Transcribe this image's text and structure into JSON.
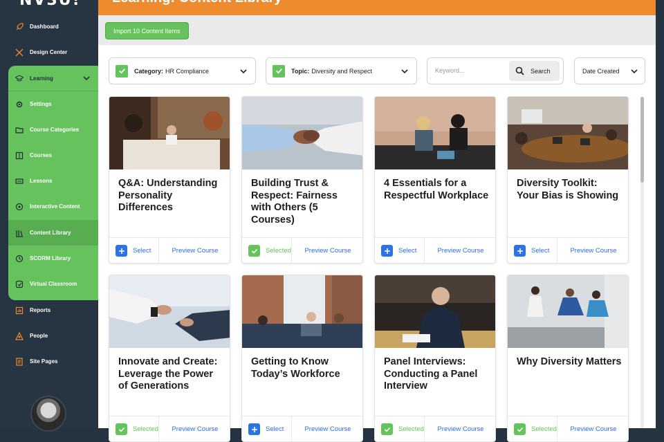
{
  "app": {
    "logo": "NV3U!"
  },
  "header": {
    "title": "Learning: Content Library",
    "import_label": "Import 10 Content Items"
  },
  "sidebar": {
    "items": [
      {
        "label": "Dashboard",
        "icon": "rocket-icon"
      },
      {
        "label": "Design Center",
        "icon": "tools-icon"
      },
      {
        "label": "Learning",
        "icon": "graduation-cap-icon"
      },
      {
        "label": "Settings",
        "icon": "gear-icon"
      },
      {
        "label": "Course Categories",
        "icon": "folder-icon"
      },
      {
        "label": "Courses",
        "icon": "book-icon"
      },
      {
        "label": "Lessons",
        "icon": "lessons-icon"
      },
      {
        "label": "Interactive Content",
        "icon": "puzzle-icon"
      },
      {
        "label": "Content Library",
        "icon": "library-icon"
      },
      {
        "label": "SCORM Library",
        "icon": "scorm-icon"
      },
      {
        "label": "Virtual Classroom",
        "icon": "classroom-icon"
      },
      {
        "label": "Reports",
        "icon": "chart-icon"
      },
      {
        "label": "People",
        "icon": "people-icon"
      },
      {
        "label": "Site Pages",
        "icon": "pages-icon"
      }
    ]
  },
  "filters": {
    "category": {
      "label": "Category:",
      "value": "HR Compliance"
    },
    "topic": {
      "label": "Topic:",
      "value": "Diversity and Respect"
    },
    "keyword_placeholder": "Keyword...",
    "search_label": "Search",
    "sort_label": "Date Created"
  },
  "cards": [
    {
      "title": "Q&A: Understanding Personality Differences",
      "select": "Select",
      "selected": false,
      "preview": "Preview Course"
    },
    {
      "title": "Building Trust & Respect: Fairness with Others (5 Courses)",
      "select": "Selected",
      "selected": true,
      "preview": "Preview Course"
    },
    {
      "title": "4 Essentials for a Respectful Workplace",
      "select": "Select",
      "selected": false,
      "preview": "Preview Course"
    },
    {
      "title": "Diversity Toolkit: Your Bias is Showing",
      "select": "Select",
      "selected": false,
      "preview": "Preview Course"
    },
    {
      "title": "Innovate and Create: Leverage the Power of Generations",
      "select": "Selected",
      "selected": true,
      "preview": "Preview Course"
    },
    {
      "title": "Getting to Know Today’s Workforce",
      "select": "Select",
      "selected": false,
      "preview": "Preview Course"
    },
    {
      "title": "Panel Interviews: Conducting a Panel Interview",
      "select": "Selected",
      "selected": true,
      "preview": "Preview Course"
    },
    {
      "title": "Why Diversity Matters",
      "select": "Selected",
      "selected": true,
      "preview": "Preview Course"
    }
  ],
  "colors": {
    "accent_orange": "#ee8b2e",
    "accent_green": "#66c25c",
    "link_blue": "#2b6fdd",
    "sidebar_dark": "#273441"
  }
}
